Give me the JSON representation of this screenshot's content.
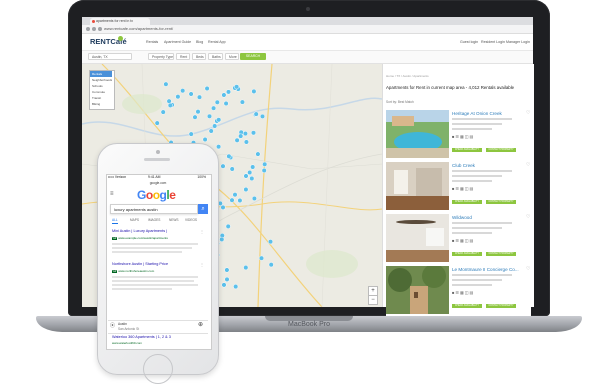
{
  "colors": {
    "accent": "#8dc63f",
    "brand": "#1d3a5c",
    "pin": "#5bc0eb",
    "link": "#1a0dab"
  },
  "laptop": {
    "brand": "MacBook Pro"
  },
  "browser": {
    "tab_title": "apartments for rent in tx",
    "url": "www.rentcafe.com/apartments-for-rent/"
  },
  "site": {
    "logo": "RENTCafé",
    "nav": [
      "Rentals",
      "Apartment Guide",
      "Blog",
      "Rental App"
    ],
    "right_nav": [
      "Guest login",
      "Resident Login",
      "Manager Login"
    ]
  },
  "filters": {
    "location": "Austin, TX",
    "chips": [
      "Property Type",
      "Rent",
      "Beds",
      "Baths",
      "More"
    ],
    "search_label": "SEARCH"
  },
  "map": {
    "layer_options": [
      "Rentals",
      "Neighborhoods",
      "Schools",
      "Commute",
      "Transit",
      "Biking"
    ],
    "zoom_in": "+",
    "zoom_out": "−"
  },
  "panel": {
    "breadcrumbs": "Home / TX / Austin / Apartments",
    "results_title": "Apartments for Rent in current map area - 4,012 Rentals available",
    "sort_label": "Sort by: Best Match",
    "listings": [
      {
        "name": "Heritage At Onion Creek",
        "theme": "pool"
      },
      {
        "name": "Club Creek",
        "theme": "room"
      },
      {
        "name": "Wildwood",
        "theme": "fan"
      },
      {
        "name": "Le Montmaure II Concierge Co...",
        "theme": "trees"
      }
    ],
    "check_label": "CHECK AVAILABILITY",
    "contact_label": "CONTACT PROPERTY"
  },
  "phone": {
    "status_carrier": "••••• Verizon",
    "status_time": "9:41 AM",
    "status_battery": "100%",
    "url": "google.com",
    "google": [
      "G",
      "o",
      "o",
      "g",
      "l",
      "e"
    ],
    "google_colors": [
      "#4285f4",
      "#ea4335",
      "#fbbc05",
      "#4285f4",
      "#34a853",
      "#ea4335"
    ],
    "search_query": "luxury apartments austin",
    "tabs": [
      "ALL",
      "MAPS",
      "IMAGES",
      "NEWS",
      "VIDEOS"
    ],
    "results": [
      {
        "title": "Mini Austin | Luxury Apartments |",
        "url": "www.example.com/austin/apartments"
      },
      {
        "title": "Northshore Austin | Starting Price",
        "url": "www.northshoreaustin.com"
      },
      {
        "title": "Waterloo 360 Apartments | 1, 2 & 3",
        "url": "www.waterloo360.com"
      }
    ],
    "ad_label": "Ad",
    "location_name": "Austin",
    "location_sub": "San Antonio St"
  }
}
